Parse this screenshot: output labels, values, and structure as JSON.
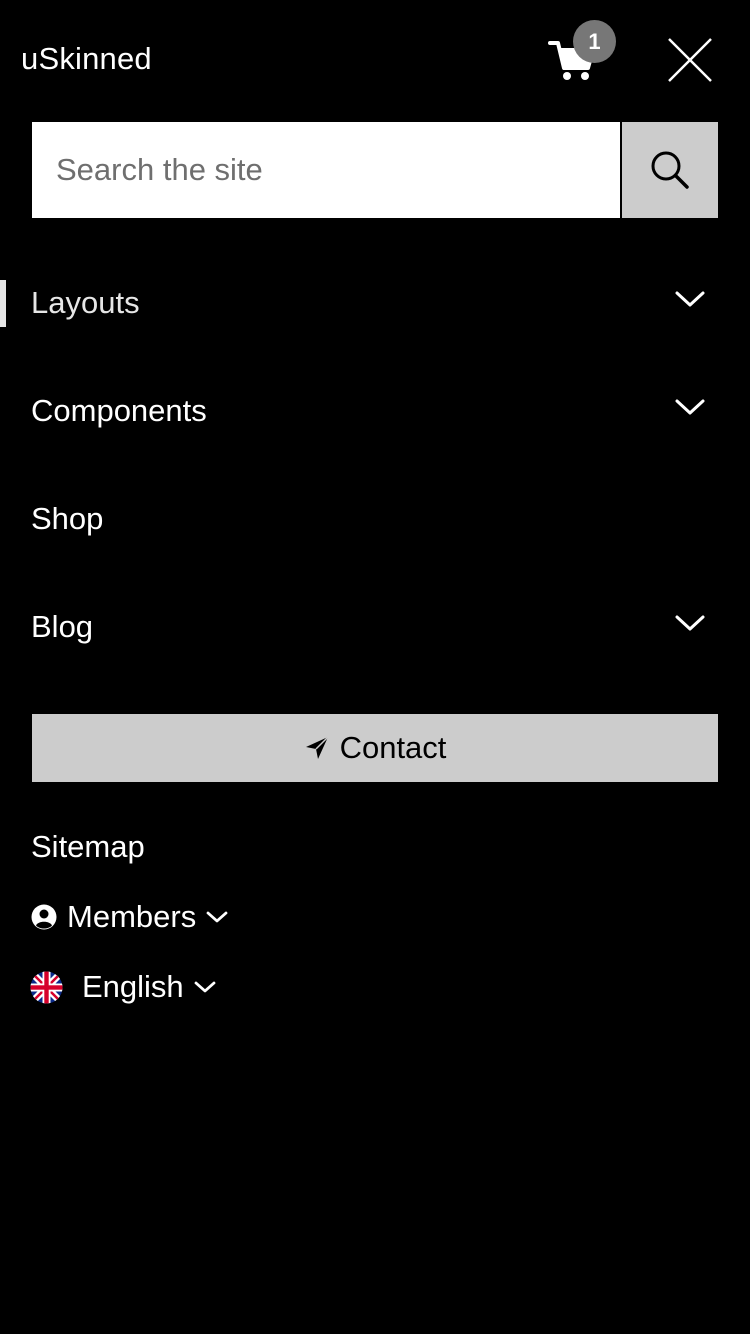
{
  "header": {
    "brand": "uSkinned",
    "cart_count": "1"
  },
  "search": {
    "placeholder": "Search the site"
  },
  "nav": {
    "items": [
      {
        "label": "Layouts",
        "has_submenu": true,
        "active": true
      },
      {
        "label": "Components",
        "has_submenu": true,
        "active": false
      },
      {
        "label": "Shop",
        "has_submenu": false,
        "active": false
      },
      {
        "label": "Blog",
        "has_submenu": true,
        "active": false
      }
    ]
  },
  "contact": {
    "label": "Contact",
    "icon": "paper-plane-icon"
  },
  "utility": {
    "sitemap": "Sitemap",
    "members": "Members",
    "members_icon": "user-circle-icon",
    "language": "English",
    "language_icon": "uk-flag-icon"
  },
  "colors": {
    "background": "#000000",
    "text": "#ffffff",
    "button_bg": "#cccccc",
    "badge_bg": "#777777",
    "search_bg": "#ffffff"
  }
}
